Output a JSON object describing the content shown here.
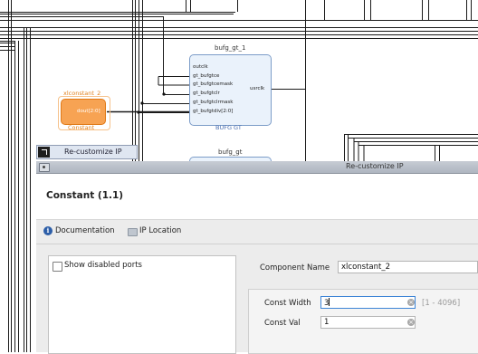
{
  "block_design": {
    "bufg_gt_1": {
      "name": "bufg_gt_1",
      "pins_left": [
        "outclk",
        "gt_bufgtce",
        "gt_bufgtcemask",
        "gt_bufgtclr",
        "gt_bufgtclrmask",
        "gt_bufgtdiv[2:0]"
      ],
      "pin_right": "usrclk",
      "type_label": "BUFG GT"
    },
    "bufg_gt": {
      "name": "bufg_gt"
    },
    "xlconstant_2": {
      "name": "xlconstant_2",
      "port": "dout[2:0]",
      "type_label": "Constant"
    },
    "colors": {
      "selected": "#f39a3f",
      "ip_box": "#eaf2fb",
      "ip_border": "#7c9cc8",
      "wire": "#1a1a1a"
    }
  },
  "floating_tab": {
    "label": "Re-customize IP"
  },
  "dialog": {
    "window_title": "Re-customize IP",
    "ip_title": "Constant (1.1)",
    "links": {
      "documentation": "Documentation",
      "ip_location": "IP Location"
    },
    "show_disabled_ports": "Show disabled ports",
    "component_name_label": "Component Name",
    "component_name_value": "xlconstant_2",
    "const_width_label": "Const Width",
    "const_width_value": "3",
    "const_width_range": "[1 - 4096]",
    "const_val_label": "Const Val",
    "const_val_value": "1"
  }
}
